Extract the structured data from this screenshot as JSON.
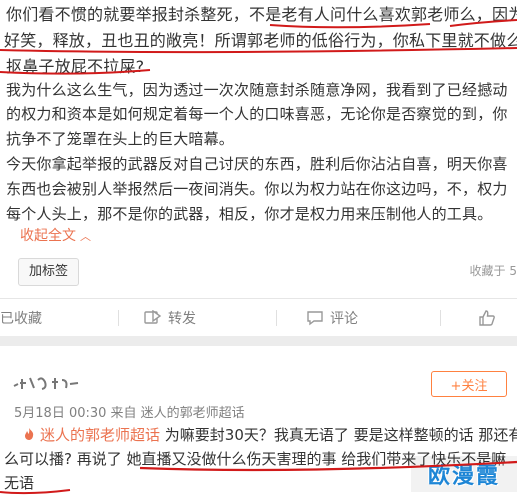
{
  "post": {
    "lines": [
      "你们看不惯的就要举报封杀整死，不是老有人问什么喜欢郭老师么，因为真",
      "好笑，释放，丑也丑的敞亮！所谓郭老师的低俗行为，你私下里就不做么，",
      "抠鼻子放屁不拉屎?",
      "我为什么这么生气，因为透过一次次随意封杀随意净网，我看到了已经撼动",
      "的权力和资本是如何规定着每一个人的口味喜恶，无论你是否察觉的到，你",
      "抗争不了笼罩在头上的巨大暗幕。",
      "今天你拿起举报的武器反对自己讨厌的东西，胜利后你沾沾自喜，明天你喜",
      "东西也会被别人举报然后一夜间消失。你以为权力站在你这边吗，不，权力",
      "每个人头上，那不是你的武器，相反，你才是权力用来压制他人的工具。"
    ],
    "collapse_label": "收起全文",
    "add_tag_label": "加标签",
    "timestamp_right": "收藏于 5"
  },
  "actions": {
    "favorite": "已收藏",
    "repost": "转发",
    "comment": "评论",
    "like": ""
  },
  "comment": {
    "follow_label": "+关注",
    "meta": "5月18日 00:30 来自 迷人的郭老师超话",
    "tag": "迷人的郭老师超话",
    "line1_rest": " 为嘛要封30天？我真无语了 要是这样整顿的话 那还有",
    "line2": "么可以播? 再说了 她直播又没做什么伤天害理的事 给我们带来了快乐不是嘛",
    "line3": "无语"
  },
  "watermark": "欧漫霞",
  "colors": {
    "link": "#eb7350",
    "follow": "#ff8140",
    "underline": "#d11a1a",
    "watermark": "#1e86d6"
  }
}
